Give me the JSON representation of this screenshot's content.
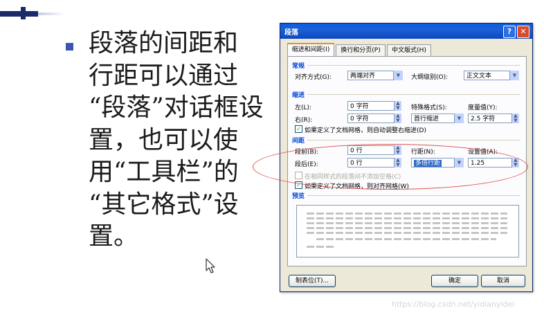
{
  "slide": {
    "lines": [
      "段落的间距和",
      "行距可以通过",
      "“段落”对话框设",
      "置，也可以使",
      "用“工具栏”的",
      "“其它格式”设",
      "置。"
    ],
    "bullet_color": "#3b55b5",
    "accent_color": "#1b2a6b"
  },
  "dialog": {
    "title": "段落",
    "help_label": "?",
    "close_label": "✕",
    "tabs": [
      "缩进和间距(I)",
      "换行和分页(P)",
      "中文版式(H)"
    ],
    "general": {
      "heading": "常规",
      "align_label": "对齐方式(G):",
      "align_value": "两端对齐",
      "outline_label": "大纲级别(O):",
      "outline_value": "正文文本"
    },
    "indent": {
      "heading": "缩进",
      "left_label": "左(L):",
      "left_value": "0 字符",
      "right_label": "右(R):",
      "right_value": "0 字符",
      "special_label": "特殊格式(S):",
      "special_value": "首行缩进",
      "measure_label": "度量值(Y):",
      "measure_value": "2.5 字符",
      "auto_adjust": "如果定义了文档网格，则自动调整右缩进(D)"
    },
    "spacing": {
      "heading": "间距",
      "before_label": "段前(B):",
      "before_value": "0 行",
      "after_label": "段后(E):",
      "after_value": "0 行",
      "line_spacing_label": "行距(N):",
      "line_spacing_value": "多倍行距",
      "at_label": "设置值(A):",
      "at_value": "1.25",
      "no_space_same_style": "在相同样式的段落间不添加空格(C)",
      "snap_to_grid": "如果定义了文档网格，则对齐网格(W)"
    },
    "preview": {
      "heading": "预览"
    },
    "buttons": {
      "tabs": "制表位(T)...",
      "ok": "确定",
      "cancel": "取消"
    }
  },
  "watermark": "https://blog.csdn.net/yidianyidei",
  "colors": {
    "annotation_ellipse": "#d9534f",
    "titlebar": "#0a5ee0"
  }
}
